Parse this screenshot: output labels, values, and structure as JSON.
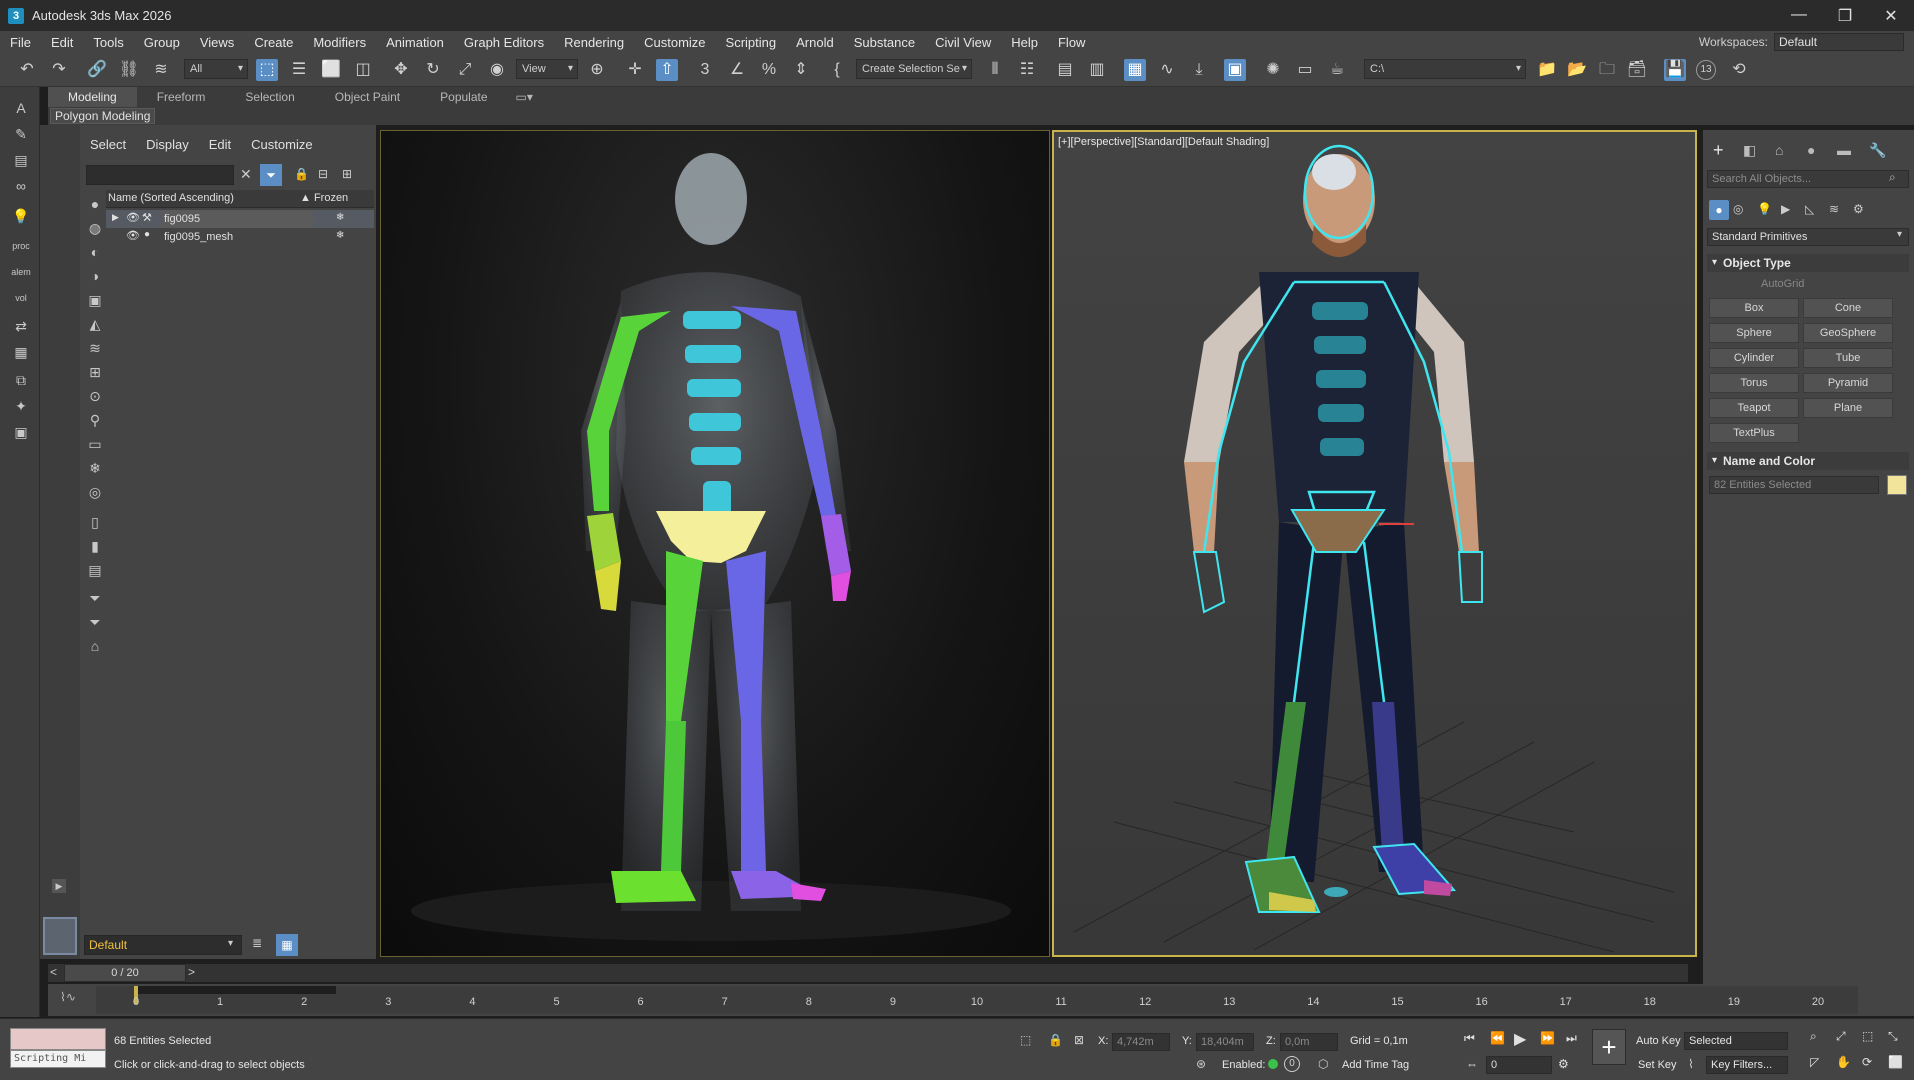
{
  "app": {
    "title": "Autodesk 3ds Max 2026",
    "icon_text": "3"
  },
  "window_controls": {
    "minimize": "—",
    "maximize": "❐",
    "close": "✕"
  },
  "menu": [
    "File",
    "Edit",
    "Tools",
    "Group",
    "Views",
    "Create",
    "Modifiers",
    "Animation",
    "Graph Editors",
    "Rendering",
    "Customize",
    "Scripting",
    "Arnold",
    "Substance",
    "Civil View",
    "Help",
    "Flow"
  ],
  "workspace": {
    "label": "Workspaces:",
    "value": "Default"
  },
  "toolbar": {
    "selection_filter": "All",
    "ref_coord": "View",
    "named_selection": "Create Selection Se",
    "path": "C:\\",
    "badge": "13"
  },
  "ribbon": {
    "tabs": [
      "Modeling",
      "Freeform",
      "Selection",
      "Object Paint",
      "Populate"
    ],
    "active_panel": "Polygon Modeling"
  },
  "scene_explorer": {
    "menu": [
      "Select",
      "Display",
      "Edit",
      "Customize"
    ],
    "columns": {
      "name": "Name (Sorted Ascending)",
      "frozen": "▲ Frozen"
    },
    "rows": [
      {
        "name": "fig0095",
        "expand": "▶",
        "eye": "👁",
        "kind": "⚒",
        "frozen": "❄"
      },
      {
        "name": "fig0095_mesh",
        "expand": "",
        "eye": "👁",
        "kind": "●",
        "frozen": "❄"
      }
    ],
    "layer": "Default"
  },
  "viewports": {
    "right_label": "[+][Perspective][Standard][Default Shading]"
  },
  "command_panel": {
    "search_placeholder": "Search All Objects...",
    "category": "Standard Primitives",
    "object_type_title": "Object Type",
    "autogrid": "AutoGrid",
    "buttons": [
      "Box",
      "Cone",
      "Sphere",
      "GeoSphere",
      "Cylinder",
      "Tube",
      "Torus",
      "Pyramid",
      "Teapot",
      "Plane",
      "TextPlus"
    ],
    "name_color_title": "Name and Color",
    "name_value": "82 Entities Selected",
    "color": "#f2e49a"
  },
  "timeline": {
    "frame": "0 / 20",
    "ticks": [
      "0",
      "1",
      "2",
      "3",
      "4",
      "5",
      "6",
      "7",
      "8",
      "9",
      "10",
      "11",
      "12",
      "13",
      "14",
      "15",
      "16",
      "17",
      "18",
      "19",
      "20"
    ]
  },
  "status": {
    "maxscript": "Scripting Mi",
    "selected": "68 Entities Selected",
    "prompt": "Click or click-and-drag to select objects",
    "x_label": "X:",
    "x": "4,742m",
    "y_label": "Y:",
    "y": "18,404m",
    "z_label": "Z:",
    "z": "0,0m",
    "grid": "Grid = 0,1m",
    "enabled_label": "Enabled:",
    "enabled_value": "0",
    "add_time_tag": "Add Time Tag",
    "auto_key": "Auto Key",
    "set_key": "Set Key",
    "key_mode": "Selected",
    "key_filters": "Key Filters...",
    "frame_value": "0"
  }
}
